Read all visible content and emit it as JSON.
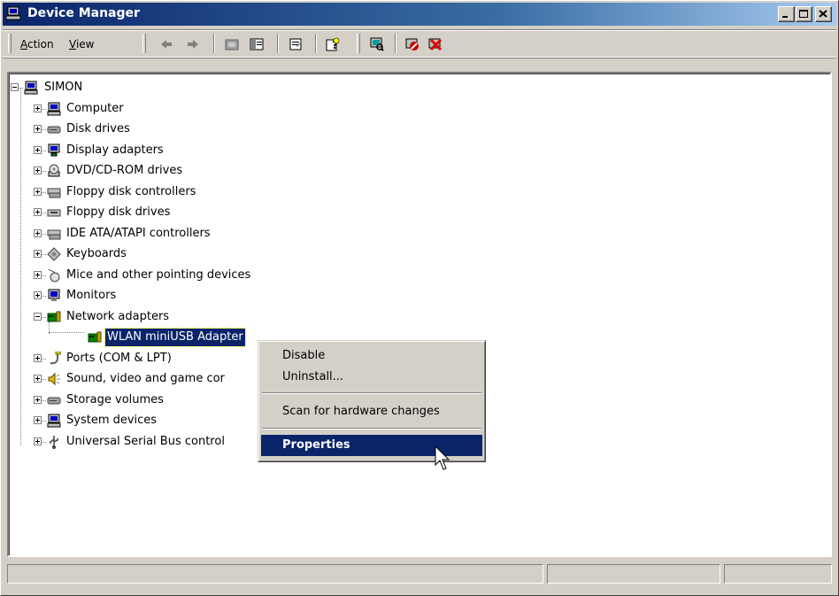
{
  "window": {
    "title": "Device Manager",
    "icon": "computer-icon",
    "controls": [
      "minimize-icon",
      "maximize-icon",
      "close-icon"
    ]
  },
  "toolbar": {
    "menu": [
      {
        "label": "Action",
        "accel": "A"
      },
      {
        "label": "View",
        "accel": "V"
      }
    ],
    "buttons": [
      "back-icon",
      "forward-icon",
      "up-folder-icon",
      "show-hide-tree-icon",
      "properties-icon",
      "help-icon",
      "scan-hardware-icon",
      "disable-device-icon",
      "uninstall-device-icon"
    ]
  },
  "tree": {
    "root": {
      "label": "SIMON",
      "expanded": true,
      "icon": "computer-icon"
    },
    "items": [
      {
        "label": "Computer",
        "icon": "computer-icon",
        "expanded": false
      },
      {
        "label": "Disk drives",
        "icon": "disk-drive-icon",
        "expanded": false
      },
      {
        "label": "Display adapters",
        "icon": "display-adapter-icon",
        "expanded": false
      },
      {
        "label": "DVD/CD-ROM drives",
        "icon": "cdrom-icon",
        "expanded": false
      },
      {
        "label": "Floppy disk controllers",
        "icon": "controller-icon",
        "expanded": false
      },
      {
        "label": "Floppy disk drives",
        "icon": "floppy-drive-icon",
        "expanded": false
      },
      {
        "label": "IDE ATA/ATAPI controllers",
        "icon": "controller-icon",
        "expanded": false
      },
      {
        "label": "Keyboards",
        "icon": "keyboard-icon",
        "expanded": false
      },
      {
        "label": "Mice and other pointing devices",
        "icon": "mouse-icon",
        "expanded": false
      },
      {
        "label": "Monitors",
        "icon": "monitor-icon",
        "expanded": false
      },
      {
        "label": "Network adapters",
        "icon": "network-adapter-icon",
        "expanded": true
      },
      {
        "label": "WLAN miniUSB Adapter",
        "icon": "network-adapter-icon",
        "child": true,
        "selected": true
      },
      {
        "label": "Ports (COM & LPT)",
        "icon": "port-icon",
        "expanded": false
      },
      {
        "label": "Sound, video and game cor",
        "icon": "sound-icon",
        "expanded": false
      },
      {
        "label": "Storage volumes",
        "icon": "disk-drive-icon",
        "expanded": false
      },
      {
        "label": "System devices",
        "icon": "computer-icon",
        "expanded": false
      },
      {
        "label": "Universal Serial Bus control",
        "icon": "usb-icon",
        "expanded": false
      }
    ]
  },
  "context_menu": {
    "items": [
      {
        "label": "Disable"
      },
      {
        "label": "Uninstall..."
      },
      {
        "separator": true
      },
      {
        "label": "Scan for hardware changes"
      },
      {
        "separator": true
      },
      {
        "label": "Properties",
        "highlighted": true
      }
    ]
  },
  "colors": {
    "selection": "#0a246a",
    "title_gradient_start": "#0a246a",
    "title_gradient_end": "#a6caf0",
    "face": "#d4d0c8"
  }
}
